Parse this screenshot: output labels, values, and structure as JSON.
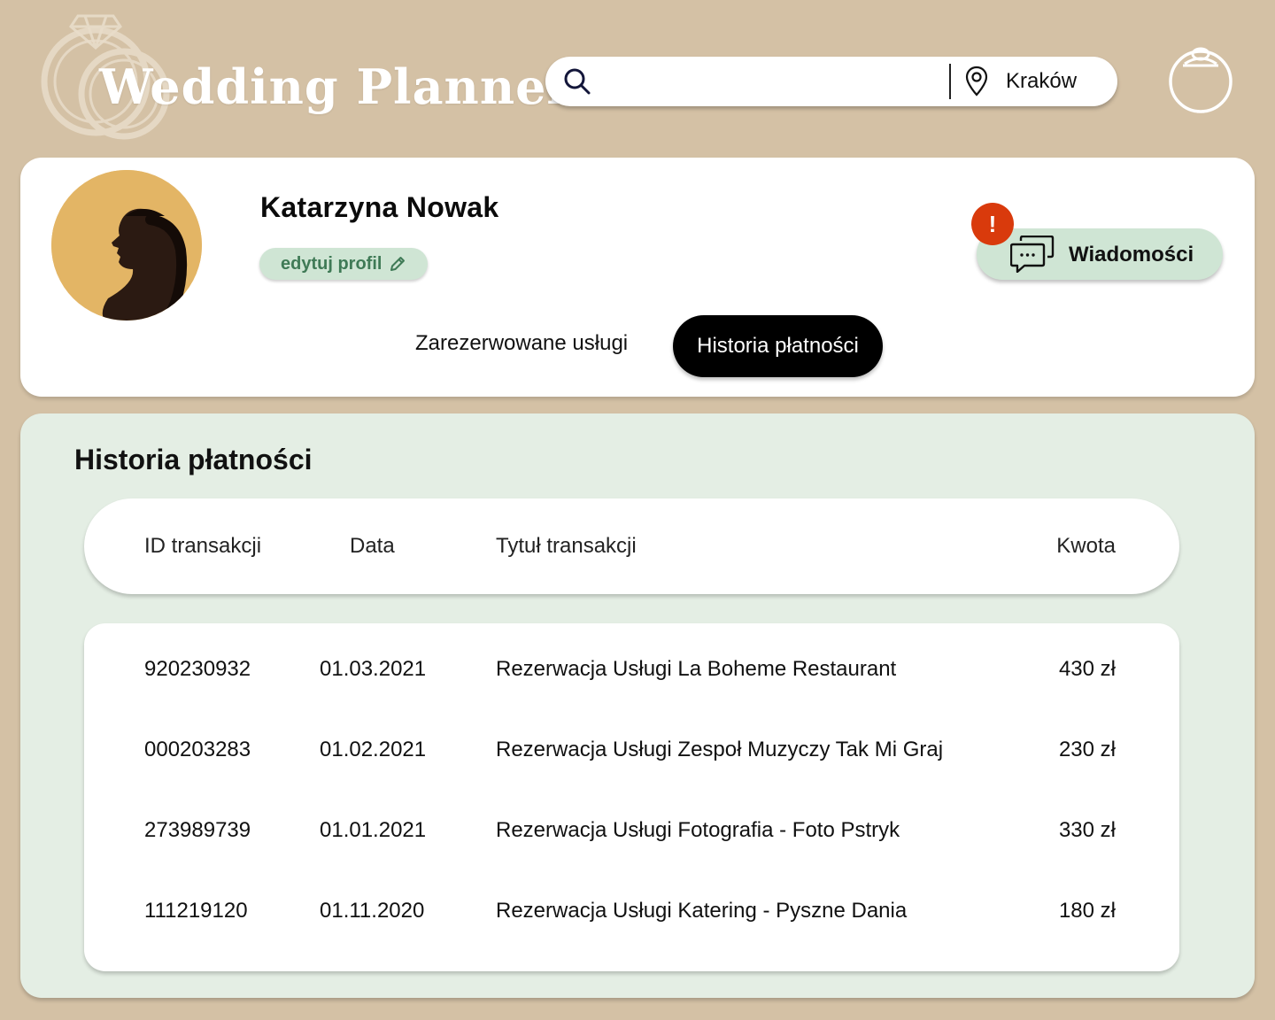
{
  "brand": {
    "name": "Wedding Planner"
  },
  "search": {
    "placeholder": "",
    "location": "Kraków"
  },
  "profile": {
    "name": "Katarzyna Nowak",
    "edit_label": "edytuj profil",
    "messages_label": "Wiadomości",
    "notification_count": "!"
  },
  "tabs": [
    {
      "label": "Zarezerwowane usługi",
      "active": false
    },
    {
      "label": "Historia płatności",
      "active": true
    }
  ],
  "history": {
    "title": "Historia płatności",
    "columns": [
      "ID transakcji",
      "Data",
      "Tytuł transakcji",
      "Kwota"
    ],
    "rows": [
      {
        "id": "920230932",
        "date": "01.03.2021",
        "title": "Rezerwacja Usługi La Boheme Restaurant",
        "amount": "430 zł"
      },
      {
        "id": "000203283",
        "date": "01.02.2021",
        "title": "Rezerwacja Usługi Zespoł Muzyczy Tak Mi Graj",
        "amount": "230 zł"
      },
      {
        "id": "273989739",
        "date": "01.01.2021",
        "title": "Rezerwacja Usługi Fotografia - Foto Pstryk",
        "amount": "330 zł"
      },
      {
        "id": "111219120",
        "date": "01.11.2020",
        "title": "Rezerwacja Usługi Katering - Pyszne Dania",
        "amount": "180 zł"
      }
    ]
  },
  "colors": {
    "background": "#d4c1a5",
    "card": "#ffffff",
    "mint": "#cfe5d4",
    "section": "#e4eee4",
    "badge": "#d93a0c",
    "active_tab": "#000000"
  },
  "icons": {
    "logo": "wedding-rings-icon",
    "search": "search-icon",
    "location": "map-pin-icon",
    "account": "ring-box-icon",
    "edit": "pencil-icon",
    "messages": "chat-bubbles-icon"
  }
}
